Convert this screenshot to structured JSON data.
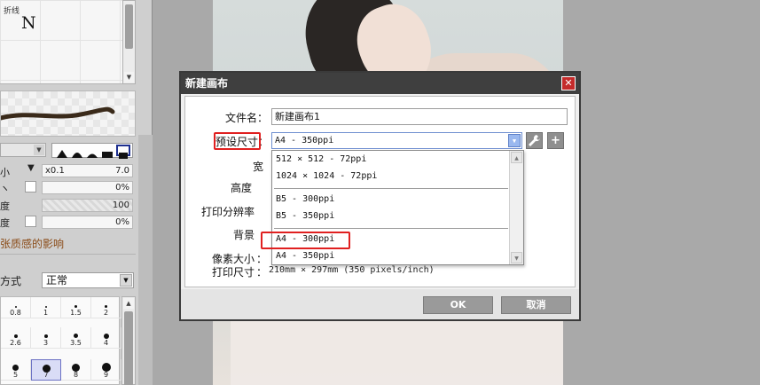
{
  "left_panel": {
    "subtool_label": "折线",
    "subtool_glyph": "N",
    "dd_arrow": "▼",
    "size_prefix": "x0.1",
    "size_value": "7.0",
    "pct1": "0%",
    "val100": "100",
    "pct2": "0%",
    "paper_texture_text": "张质感的影响",
    "combine_label": "方式",
    "combine_value": "正常",
    "partial_labels": [
      "小",
      "ヽ",
      "度",
      "度"
    ],
    "brush_sizes": [
      {
        "label": "0.8"
      },
      {
        "label": "1"
      },
      {
        "label": "1.5"
      },
      {
        "label": "2"
      },
      {
        "label": "2.6"
      },
      {
        "label": "3"
      },
      {
        "label": "3.5"
      },
      {
        "label": "4"
      },
      {
        "label": "5"
      },
      {
        "label": "7"
      },
      {
        "label": "8"
      },
      {
        "label": "9"
      }
    ],
    "selected_size": "7"
  },
  "dialog": {
    "title": "新建画布",
    "close_glyph": "✕",
    "filename_label": "文件名：",
    "filename_value": "新建画布1",
    "preset_label": "预设尺寸",
    "preset_value": "A4 - 350ppi",
    "width_label": "宽",
    "height_label": "高度",
    "dpi_label": "打印分辨率",
    "bg_label": "背景",
    "pixel_label": "像素大小",
    "print_label": "打印尺寸",
    "print_value": "210mm × 297mm (350 pixels/inch)",
    "colon": "：",
    "preset_options": [
      "512 × 512 - 72ppi",
      "1024 × 1024 - 72ppi",
      "B5 - 300ppi",
      "B5 - 350ppi",
      "A4 - 300ppi",
      "A4 - 350ppi"
    ],
    "ok_label": "OK",
    "cancel_label": "取消",
    "wrench_glyph": "🔧",
    "plus_glyph": "+"
  },
  "colors": {
    "dialog_title_bg": "#3f3f3f",
    "close_bg": "#c42b2b",
    "highlight_red": "#e02020",
    "select_accent": "#9ab8ef"
  }
}
